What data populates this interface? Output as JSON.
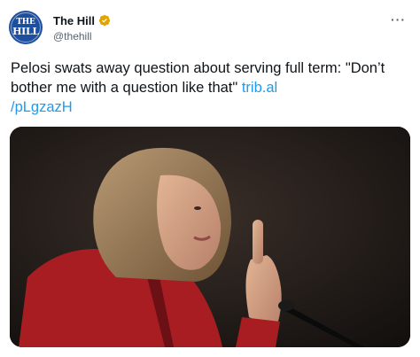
{
  "account": {
    "display_name": "The Hill",
    "handle": "@thehill",
    "avatar_text_top": "THE",
    "avatar_text_bottom": "HILL",
    "verified_icon": "verified-badge-icon"
  },
  "more_icon": "more-options-icon",
  "tweet": {
    "text": "Pelosi swats away question about serving full term: \"Don’t bother me with a question like that\" ",
    "link_line1": "trib.al",
    "link_line2": "/pLgzazH"
  },
  "media": {
    "kind": "photo",
    "subject": "woman gesturing with raised index finger at a microphone"
  },
  "colors": {
    "link": "#1d9bf0",
    "verified": "#e2a400",
    "avatar_bg": "#1d4f9e",
    "text": "#0f1419",
    "secondary_text": "#536471"
  }
}
